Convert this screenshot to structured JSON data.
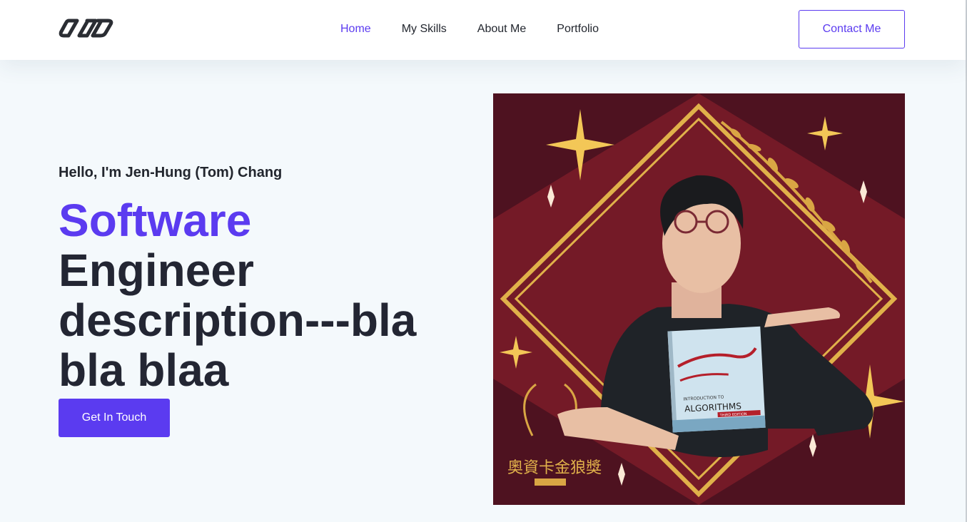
{
  "header": {
    "nav": [
      {
        "label": "Home",
        "active": true
      },
      {
        "label": "My Skills",
        "active": false
      },
      {
        "label": "About Me",
        "active": false
      },
      {
        "label": "Portfolio",
        "active": false
      }
    ],
    "contact_label": "Contact Me"
  },
  "hero": {
    "greeting": "Hello, I'm Jen-Hung (Tom) Chang",
    "headline_accent": "Software",
    "headline_rest": "Engineer description---bla bla blaa",
    "cta_label": "Get In Touch",
    "image": {
      "description_icon": "portrait-photo",
      "award_text": "奧資卡金狼獎",
      "book_title": "ALGORITHMS",
      "book_subtitle": "INTRODUCTION TO",
      "book_edition": "THIRD EDITION"
    }
  },
  "colors": {
    "accent": "#5b3bf0",
    "text_dark": "#232633",
    "background": "#f4f9fc",
    "poster_bg": "#4e1220",
    "poster_diamond": "#751a26",
    "gold": "#e0b14a"
  }
}
